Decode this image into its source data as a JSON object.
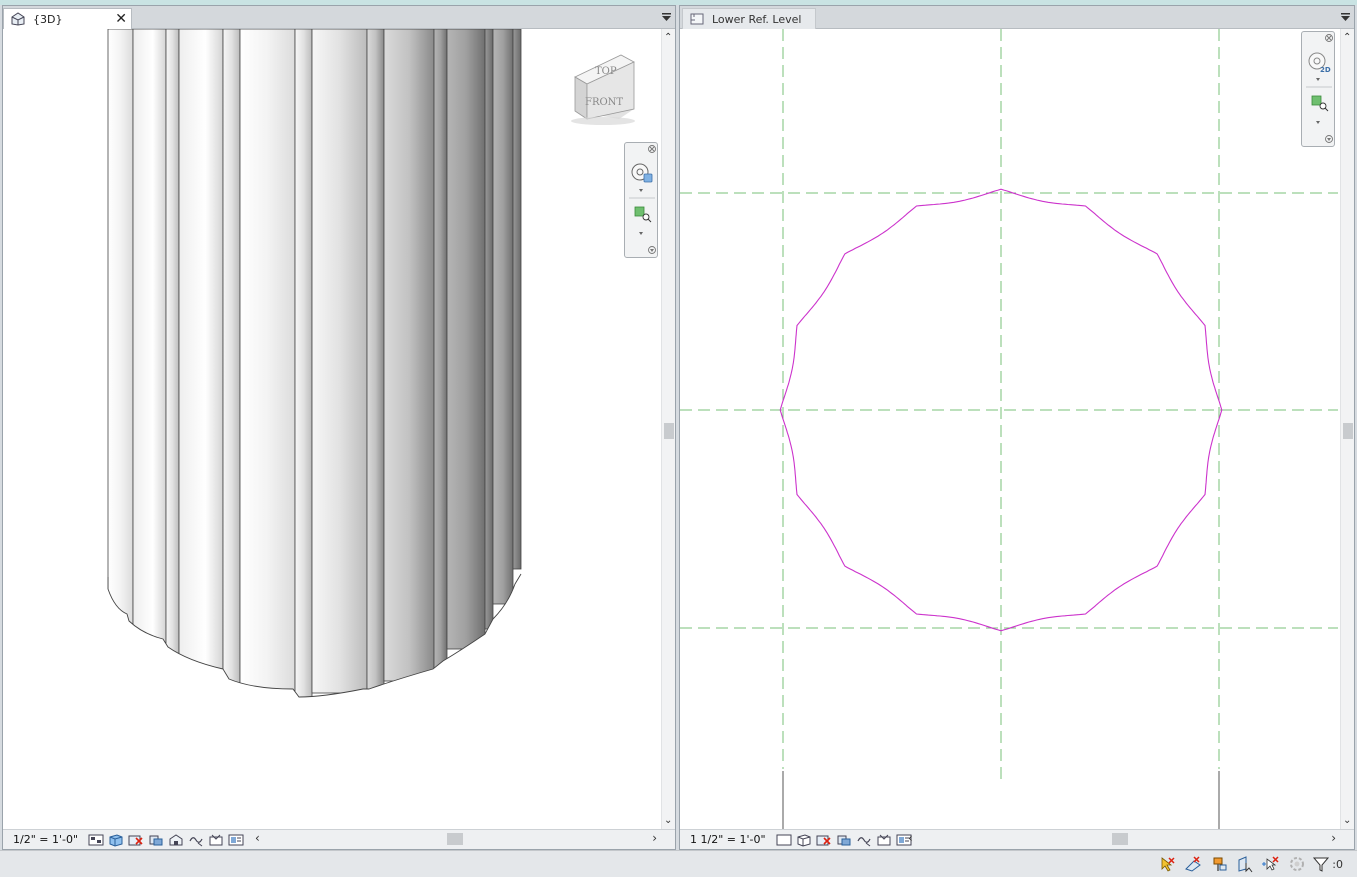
{
  "left_view": {
    "tab_label": "{3D}",
    "scale": "1/2\" = 1'-0\"",
    "viewcube": {
      "top": "TOP",
      "front": "FRONT"
    }
  },
  "right_view": {
    "tab_label": "Lower Ref. Level",
    "scale": "1 1/2\" = 1'-0\""
  },
  "status": {
    "filter_count": ":0"
  },
  "colors": {
    "profile": "#cc33cc",
    "ref_plane": "#7ac27a",
    "accent": "#2a73c9"
  }
}
